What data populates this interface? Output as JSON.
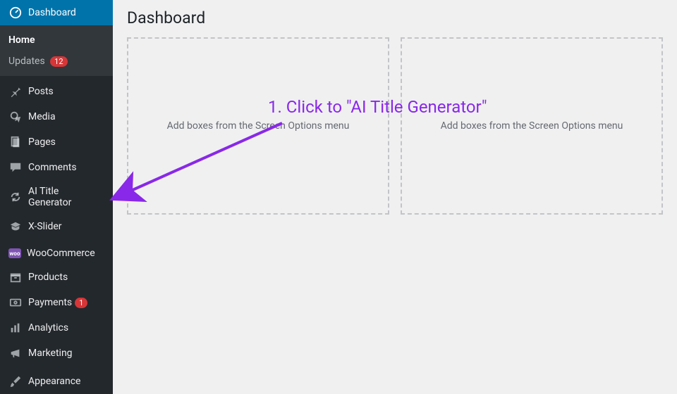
{
  "page": {
    "title": "Dashboard"
  },
  "sidebar": {
    "dashboard": {
      "label": "Dashboard"
    },
    "submenu": {
      "home": "Home",
      "updates": "Updates",
      "updates_badge": "12"
    },
    "posts": "Posts",
    "media": "Media",
    "pages": "Pages",
    "comments": "Comments",
    "ai_title": "AI Title Generator",
    "xslider": "X-Slider",
    "woocommerce": "WooCommerce",
    "products": "Products",
    "payments": "Payments",
    "payments_badge": "1",
    "analytics": "Analytics",
    "marketing": "Marketing",
    "appearance": "Appearance"
  },
  "widgets": {
    "placeholder": "Add boxes from the Screen Options menu"
  },
  "annotation": {
    "text": "1. Click to \"AI Title Generator\""
  }
}
